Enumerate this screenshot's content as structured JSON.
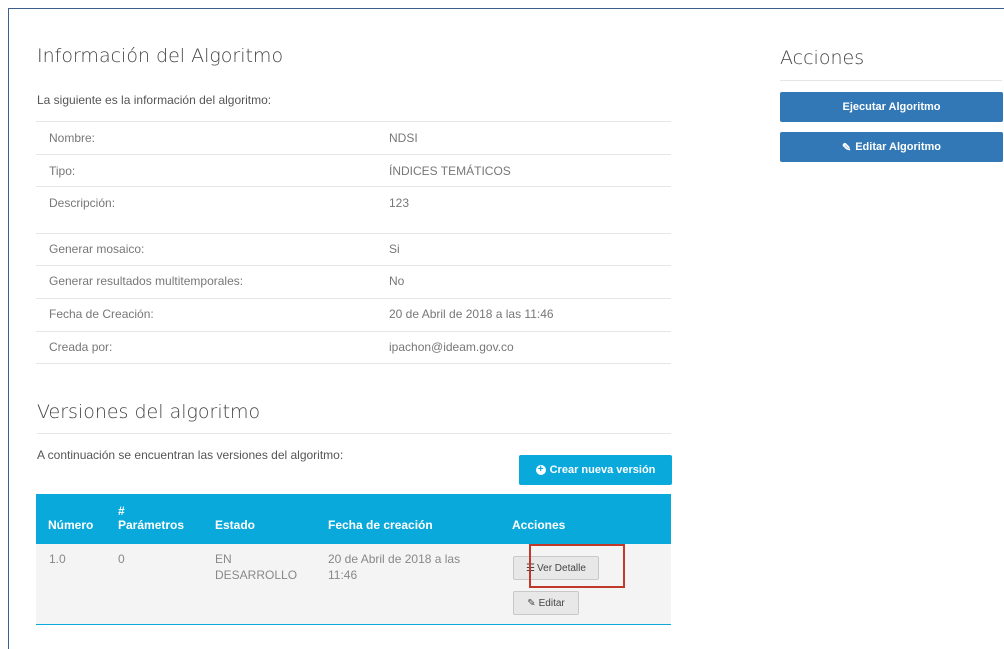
{
  "info": {
    "title": "Información del Algoritmo",
    "subtitle": "La siguiente es la información del algoritmo:",
    "rows": [
      {
        "label": "Nombre:",
        "value": "NDSI"
      },
      {
        "label": "Tipo:",
        "value": "ÍNDICES TEMÁTICOS"
      },
      {
        "label": "Descripción:",
        "value": "123"
      },
      {
        "label": "Generar mosaico:",
        "value": "Si"
      },
      {
        "label": "Generar resultados multitemporales:",
        "value": "No"
      },
      {
        "label": "Fecha de Creación:",
        "value": "20 de Abril de 2018 a las 11:46"
      },
      {
        "label": "Creada por:",
        "value": "ipachon@ideam.gov.co"
      }
    ]
  },
  "actions": {
    "title": "Acciones",
    "run_label": "Ejecutar Algoritmo",
    "edit_label": "Editar Algoritmo"
  },
  "versions": {
    "title": "Versiones del algoritmo",
    "subtitle": "A continuación se encuentran las versiones del algoritmo:",
    "new_version_label": "Crear nueva versión",
    "columns": {
      "number": "Número",
      "params_hash": "#",
      "params": "Parámetros",
      "state": "Estado",
      "date": "Fecha de creación",
      "actions": "Acciones"
    },
    "rows": [
      {
        "number": "1.0",
        "params": "0",
        "state_1": "EN",
        "state_2": "DESARROLLO",
        "date_1": "20 de Abril de 2018 a las",
        "date_2": "11:46",
        "detail_label": "Ver Detalle",
        "edit_label": "Editar"
      }
    ]
  },
  "colors": {
    "primary": "#3278b7",
    "accent": "#0aa9dc",
    "highlight": "#c0392b"
  }
}
